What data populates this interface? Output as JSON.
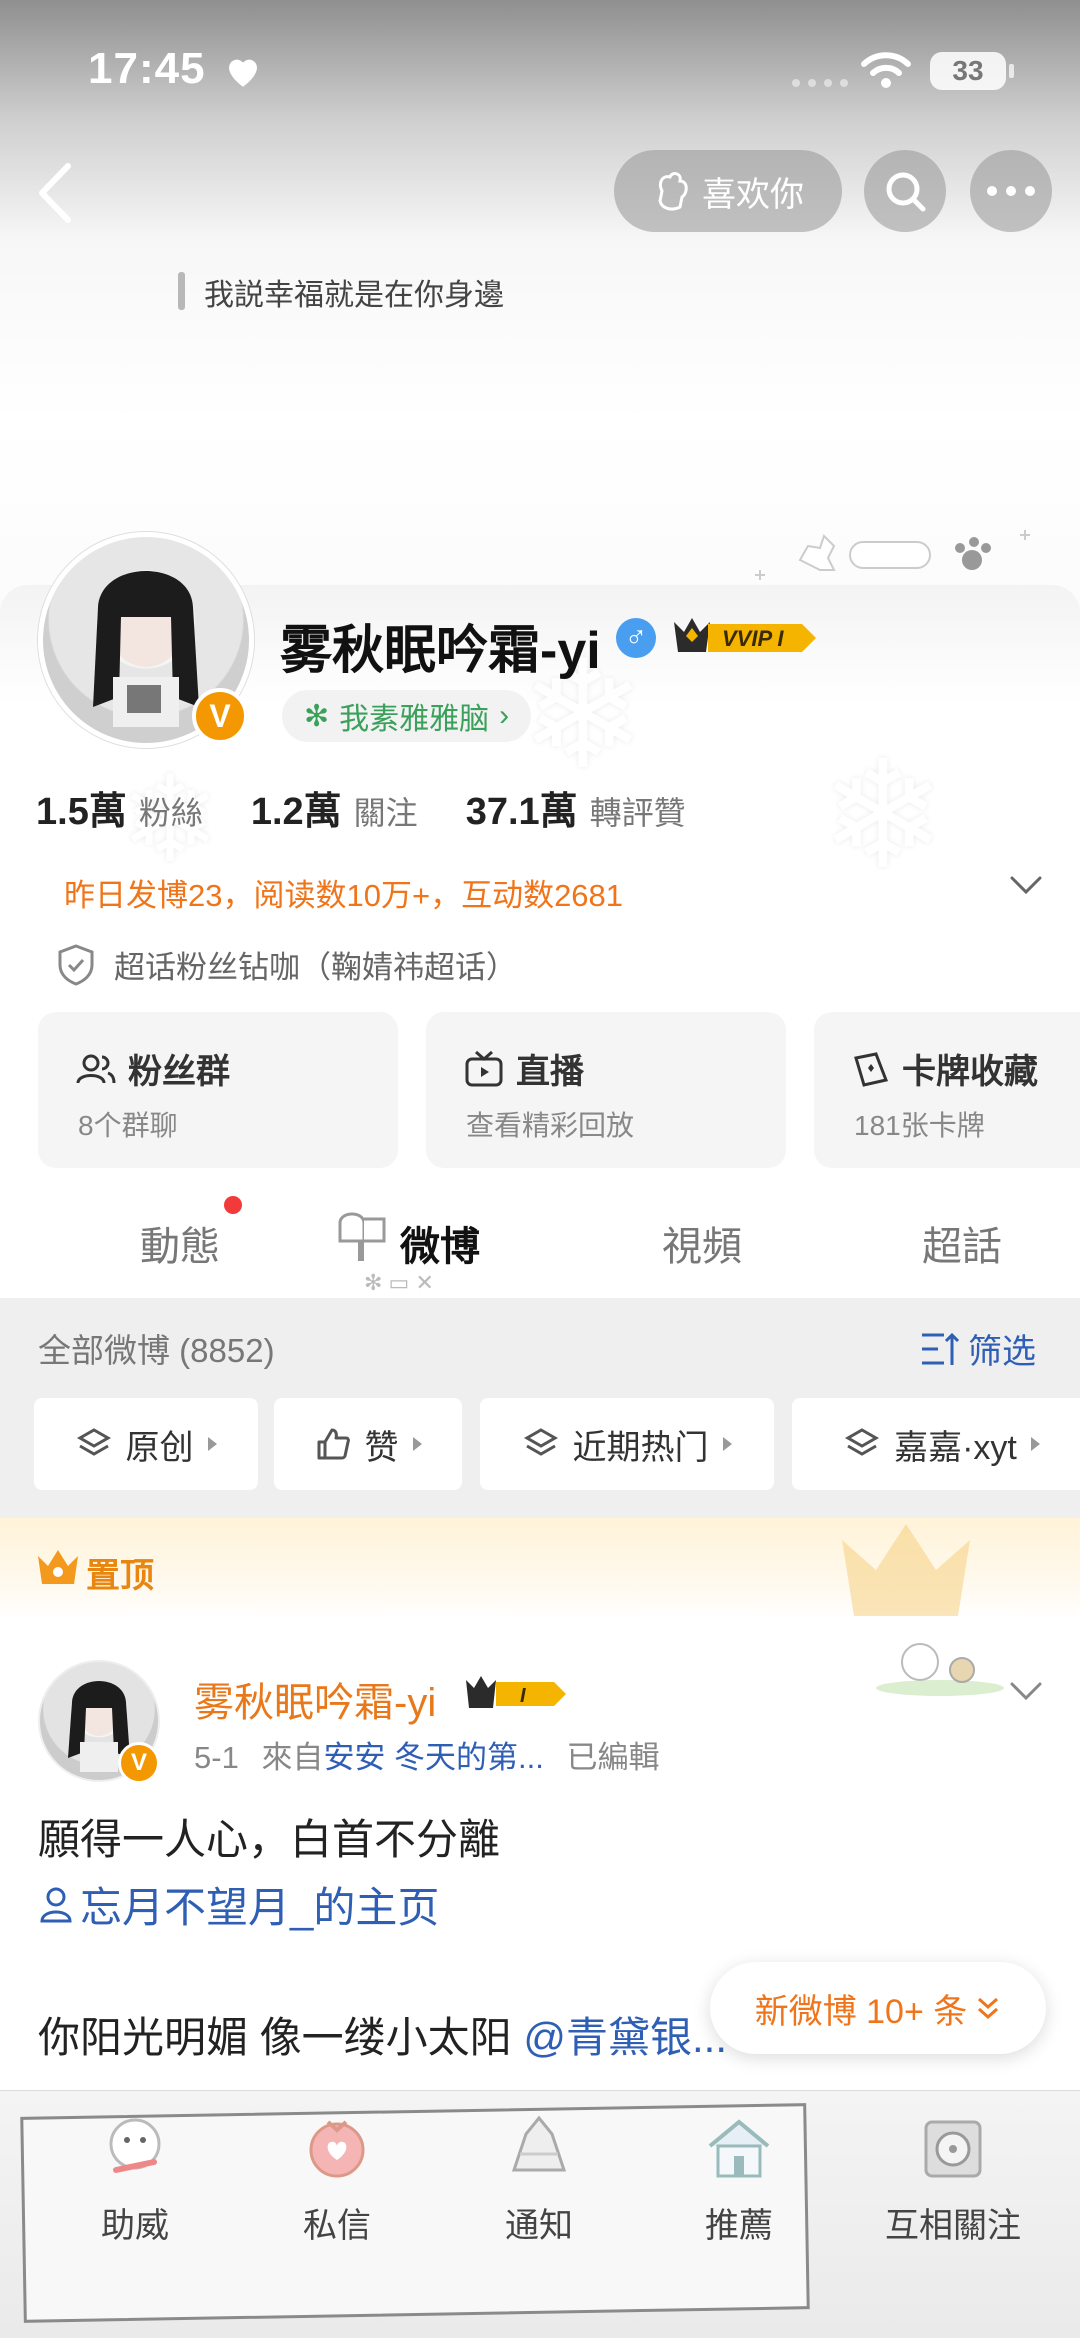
{
  "status_bar": {
    "time": "17:45",
    "battery": "33"
  },
  "header": {
    "like_label": "喜欢你"
  },
  "bio": "我説幸福就是在你身邊",
  "profile": {
    "avatar_badge": "V",
    "username": "雾秋眠吟霜-yi",
    "gender": "♂",
    "vip_label": "VVIP I",
    "tag": "我素雅雅脑",
    "stats": [
      {
        "value": "1.5萬",
        "label": "粉絲"
      },
      {
        "value": "1.2萬",
        "label": "關注"
      },
      {
        "value": "37.1萬",
        "label": "轉評贊"
      }
    ],
    "activity": "昨日发博23，阅读数10万+，互动数2681",
    "chaohua": "超话粉丝钻咖（鞠婧祎超话）"
  },
  "features": [
    {
      "title": "粉丝群",
      "sub": "8个群聊",
      "icon": "group-icon"
    },
    {
      "title": "直播",
      "sub": "查看精彩回放",
      "icon": "tv-icon"
    },
    {
      "title": "卡牌收藏",
      "sub": "181张卡牌",
      "icon": "card-icon"
    }
  ],
  "tabs": [
    {
      "label": "動態"
    },
    {
      "label": "微博"
    },
    {
      "label": "視頻"
    },
    {
      "label": "超話"
    }
  ],
  "filter": {
    "all_label": "全部微博 (8852)",
    "filter_label": "筛选",
    "chips": [
      {
        "label": "原创",
        "icon": "layers-icon"
      },
      {
        "label": "赞",
        "icon": "thumb-up-icon"
      },
      {
        "label": "近期热门",
        "icon": "layers-icon"
      },
      {
        "label": "嘉嘉·xyt",
        "icon": "layers-icon"
      }
    ]
  },
  "pinned": {
    "label": "置顶"
  },
  "post": {
    "author": "雾秋眠吟霜-yi",
    "vip_label": "I",
    "date": "5-1",
    "from_prefix": "來自",
    "source": "安安 冬天的第...",
    "edited": "已編輯",
    "line1": "願得一人心，白首不分離",
    "link": "忘月不望月_的主页",
    "line2": "你阳光明媚 像一缕小太阳",
    "mention": "@青黛银..."
  },
  "new_posts": "新微博 10+ 条",
  "bottom_nav": [
    {
      "label": "助威",
      "icon": "cheer-icon"
    },
    {
      "label": "私信",
      "icon": "message-icon"
    },
    {
      "label": "通知",
      "icon": "bell-icon"
    },
    {
      "label": "推薦",
      "icon": "house-icon"
    },
    {
      "label": "互相關注",
      "icon": "disc-icon"
    }
  ],
  "colors": {
    "accent": "#f0751a",
    "link": "#2f5fb5",
    "vip": "#f5b400"
  }
}
